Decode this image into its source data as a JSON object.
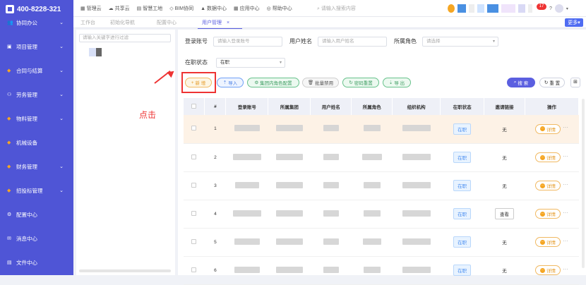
{
  "phone": "400-8228-321",
  "sidebar": {
    "items": [
      {
        "label": "协同办公",
        "icon": "people-icon",
        "chevron": true
      },
      {
        "label": "项目管理",
        "icon": "project-icon",
        "chevron": true
      },
      {
        "label": "合同与结算",
        "icon": "diamond-icon",
        "chevron": true
      },
      {
        "label": "劳务管理",
        "icon": "worker-icon",
        "chevron": true
      },
      {
        "label": "物料管理",
        "icon": "diamond-icon",
        "chevron": true
      },
      {
        "label": "机械设备",
        "icon": "diamond-icon",
        "chevron": false
      },
      {
        "label": "财务管理",
        "icon": "diamond-icon",
        "chevron": true
      },
      {
        "label": "招投标管理",
        "icon": "diamond-icon",
        "chevron": true
      },
      {
        "label": "配置中心",
        "icon": "gear-icon",
        "chevron": false
      },
      {
        "label": "消息中心",
        "icon": "message-icon",
        "chevron": false
      },
      {
        "label": "文件中心",
        "icon": "file-icon",
        "chevron": false
      }
    ]
  },
  "topnav": [
    "管理云",
    "共享云",
    "智慧工地",
    "BIM协同",
    "数据中心",
    "应用中心",
    "帮助中心"
  ],
  "search_placeholder": "请输入搜索内容",
  "badge_count": "17",
  "tabs": [
    "工作台",
    "初始化导航",
    "配置中心",
    "用户管理"
  ],
  "more_label": "更多",
  "tree_search_placeholder": "请输入关键字进行过滤",
  "filters": {
    "account_label": "登录账号",
    "account_placeholder": "请输入登录账号",
    "name_label": "用户姓名",
    "name_placeholder": "请输入用户姓名",
    "role_label": "所属角色",
    "role_placeholder": "请选择",
    "status_label": "在职状态",
    "status_value": "在职"
  },
  "actions": {
    "add": "新 增",
    "import": "导入",
    "group_role": "集团内角色配置",
    "batch_disable": "批量禁用",
    "reset_pwd": "密码重置",
    "export": "导 出",
    "search": "搜 索",
    "reset": "重 置"
  },
  "annotation": "点击",
  "table": {
    "headers": [
      "#",
      "登录账号",
      "所属集团",
      "用户姓名",
      "所属角色",
      "组织机构",
      "在职状态",
      "邀请链接",
      "操作"
    ],
    "rows": [
      {
        "index": "1",
        "status": "在职",
        "invite": "无",
        "detail": "详情"
      },
      {
        "index": "2",
        "status": "在职",
        "invite": "无",
        "detail": "详情"
      },
      {
        "index": "3",
        "status": "在职",
        "invite": "无",
        "detail": "详情"
      },
      {
        "index": "4",
        "status": "在职",
        "invite": "查看",
        "detail": "详情"
      },
      {
        "index": "5",
        "status": "在职",
        "invite": "无",
        "detail": "详情"
      },
      {
        "index": "6",
        "status": "在职",
        "invite": "无",
        "detail": "详情"
      }
    ]
  },
  "colors": {
    "sidebar": "#4f55d6",
    "accent": "#5b5fe0",
    "add": "#e69c2a",
    "annotation": "#ee3333"
  }
}
